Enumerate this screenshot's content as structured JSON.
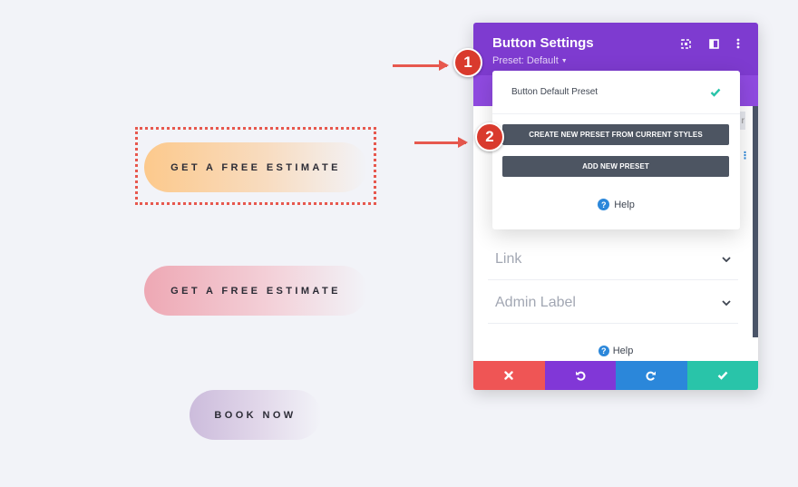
{
  "canvas": {
    "buttons": [
      {
        "label": "GET A FREE ESTIMATE",
        "selected": true
      },
      {
        "label": "GET A FREE ESTIMATE",
        "selected": false
      },
      {
        "label": "BOOK NOW",
        "selected": false
      }
    ]
  },
  "annotations": {
    "badge_1": "1",
    "badge_2": "2"
  },
  "panel": {
    "title": "Button Settings",
    "preset_label": "Preset: Default",
    "header_icons": [
      "expand-icon",
      "split-view-icon",
      "more-options-icon"
    ],
    "sections": [
      {
        "label": "Link"
      },
      {
        "label": "Admin Label"
      }
    ],
    "help_label": "Help",
    "footer": [
      "discard-icon",
      "undo-icon",
      "redo-icon",
      "save-icon"
    ]
  },
  "preset_dropdown": {
    "default_item": "Button Default Preset",
    "create_button": "CREATE NEW PRESET FROM CURRENT STYLES",
    "add_button": "ADD NEW PRESET",
    "help_label": "Help"
  },
  "colors": {
    "header": "#7e3bd0",
    "annotation_red": "#d93a2d",
    "discard": "#ef5555",
    "undo": "#8137d7",
    "redo": "#2b87da",
    "save": "#29c4a9"
  }
}
